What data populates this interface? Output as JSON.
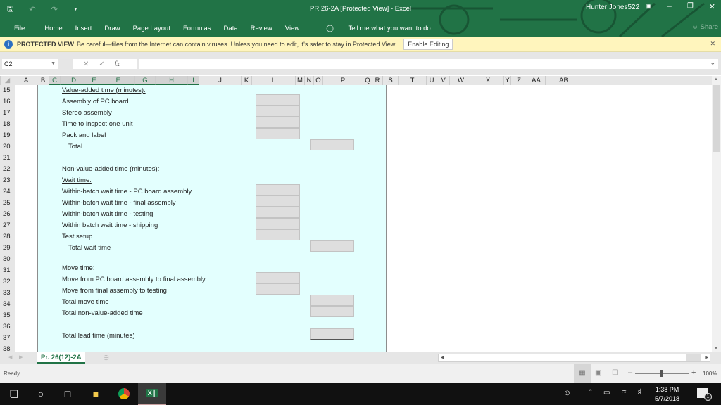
{
  "app": {
    "title": "PR 26-2A  [Protected View]  -  Excel",
    "user": "Hunter Jones522"
  },
  "ribbon": {
    "tabs": [
      "File",
      "Home",
      "Insert",
      "Draw",
      "Page Layout",
      "Formulas",
      "Data",
      "Review",
      "View"
    ],
    "tell_me": "Tell me what you want to do",
    "share": "Share"
  },
  "protected_view": {
    "label": "PROTECTED VIEW",
    "message": "Be careful—files from the Internet can contain viruses. Unless you need to edit, it's safer to stay in Protected View.",
    "button": "Enable Editing"
  },
  "formula_bar": {
    "name_box": "C2",
    "formula": "",
    "fx": "fx"
  },
  "columns": [
    "A",
    "B",
    "C",
    "D",
    "E",
    "F",
    "G",
    "H",
    "I",
    "J",
    "K",
    "L",
    "M",
    "N",
    "O",
    "P",
    "Q",
    "R",
    "S",
    "T",
    "U",
    "V",
    "W",
    "X",
    "Y",
    "Z",
    "AA",
    "AB"
  ],
  "rows": [
    "15",
    "16",
    "17",
    "18",
    "19",
    "20",
    "21",
    "22",
    "23",
    "24",
    "25",
    "26",
    "27",
    "28",
    "29",
    "30",
    "31",
    "32",
    "33",
    "34",
    "35",
    "36",
    "37",
    "38"
  ],
  "sheet": {
    "value_added_header": "Value-added time (minutes):",
    "assembly_pc": "Assembly of PC board",
    "stereo": "Stereo assembly",
    "inspect": "Time to inspect one unit",
    "pack": "Pack and label",
    "total": "Total",
    "nva_header": "Non-value-added time (minutes):",
    "wait_header": "Wait time:",
    "wait_pc": "Within-batch wait time - PC board assembly",
    "wait_final": "Within-batch wait time - final assembly",
    "wait_test": "Within-batch wait time - testing",
    "wait_ship": "Within batch wait time - shipping",
    "test_setup": "Test setup",
    "total_wait": "Total wait time",
    "move_header": "Move time:",
    "move_pc": "Move from PC board assembly to final assembly",
    "move_final": "Move from final assembly to testing",
    "total_move": "Total move time",
    "total_nva": "Total non-value-added time",
    "total_lead": "Total lead time (minutes)"
  },
  "sheet_tab": "Pr. 26(12)-2A",
  "status": {
    "ready": "Ready",
    "zoom": "100%"
  },
  "taskbar": {
    "time": "1:38 PM",
    "date": "5/7/2018",
    "notifications": "1"
  }
}
